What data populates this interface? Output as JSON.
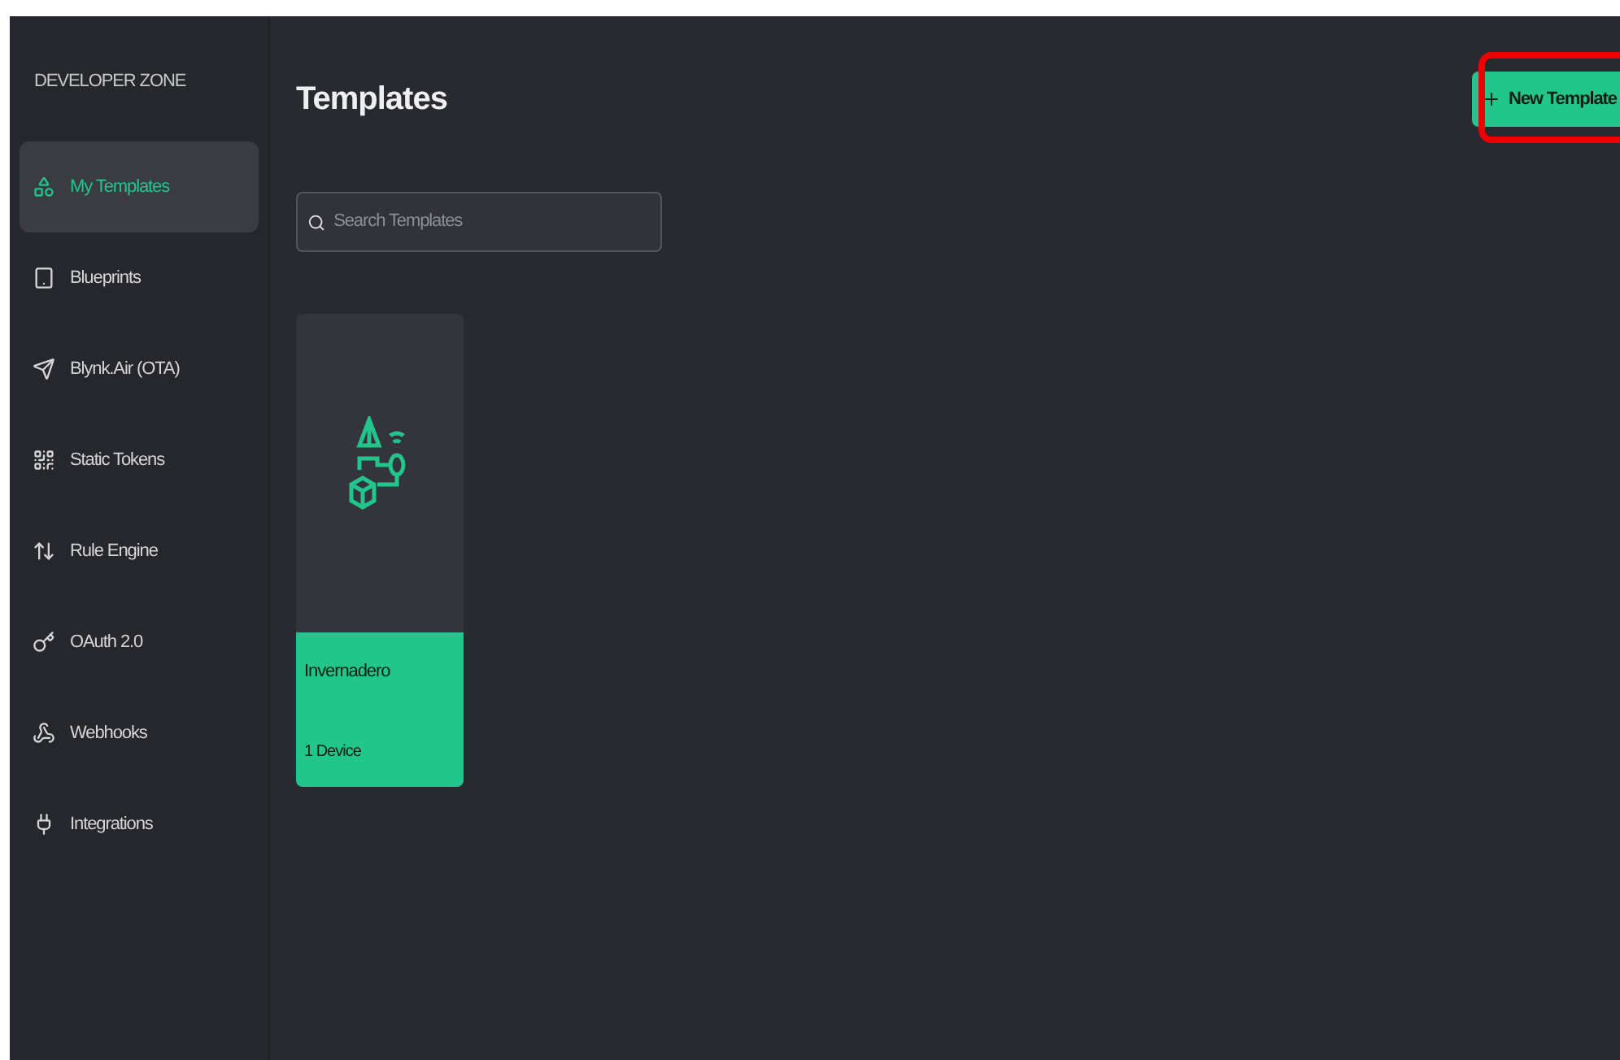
{
  "sidebar": {
    "header": "DEVELOPER ZONE",
    "items": [
      {
        "label": "My Templates",
        "selected": true
      },
      {
        "label": "Blueprints",
        "selected": false
      },
      {
        "label": "Blynk.Air (OTA)",
        "selected": false
      },
      {
        "label": "Static Tokens",
        "selected": false
      },
      {
        "label": "Rule Engine",
        "selected": false
      },
      {
        "label": "OAuth 2.0",
        "selected": false
      },
      {
        "label": "Webhooks",
        "selected": false
      },
      {
        "label": "Integrations",
        "selected": false
      }
    ]
  },
  "page": {
    "title": "Templates",
    "new_button": {
      "label": "New Template",
      "annotated": true
    },
    "search": {
      "placeholder": "Search Templates"
    }
  },
  "templates": [
    {
      "name": "Invernadero",
      "devices": "1 Device"
    }
  ]
}
